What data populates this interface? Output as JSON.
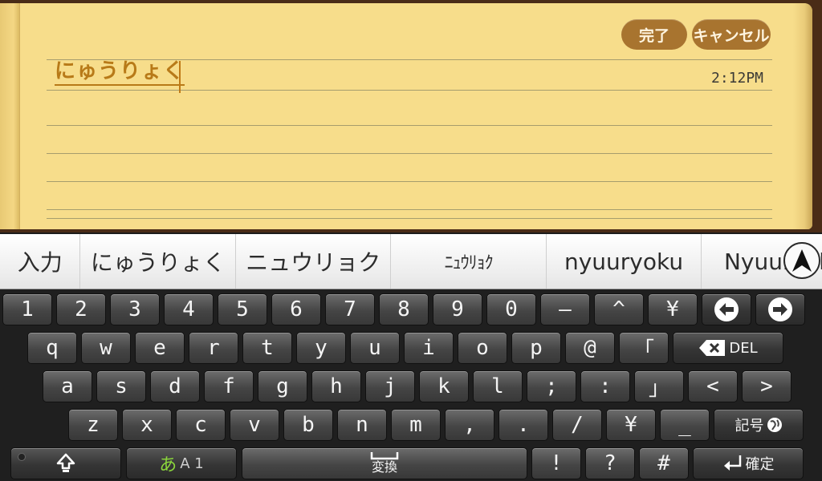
{
  "note": {
    "done_label": "完了",
    "cancel_label": "キャンセル",
    "composing_text": "にゅうりょく",
    "time": "2:12PM"
  },
  "candidates": [
    "入力",
    "にゅうりょく",
    "ニュウリョク",
    "ﾆｭｳﾘｮｸ",
    "nyuuryoku",
    "Nyuuryoku"
  ],
  "keyboard": {
    "row1": [
      "1",
      "2",
      "3",
      "4",
      "5",
      "6",
      "7",
      "8",
      "9",
      "0",
      "—",
      "^",
      "¥"
    ],
    "row2": [
      "q",
      "w",
      "e",
      "r",
      "t",
      "y",
      "u",
      "i",
      "o",
      "p",
      "@",
      "「"
    ],
    "row3": [
      "a",
      "s",
      "d",
      "f",
      "g",
      "h",
      "j",
      "k",
      "l",
      ";",
      ":",
      "」",
      "<",
      ">"
    ],
    "row4": [
      "z",
      "x",
      "c",
      "v",
      "b",
      "n",
      "m",
      ",",
      ".",
      "/",
      "¥",
      "_"
    ],
    "row5": [
      "!",
      "?",
      "#"
    ],
    "del_label": "DEL",
    "symbol_label": "記号",
    "mode_kana": "あ",
    "mode_rest": "A 1",
    "convert_label": "変換",
    "enter_label": "確定"
  }
}
